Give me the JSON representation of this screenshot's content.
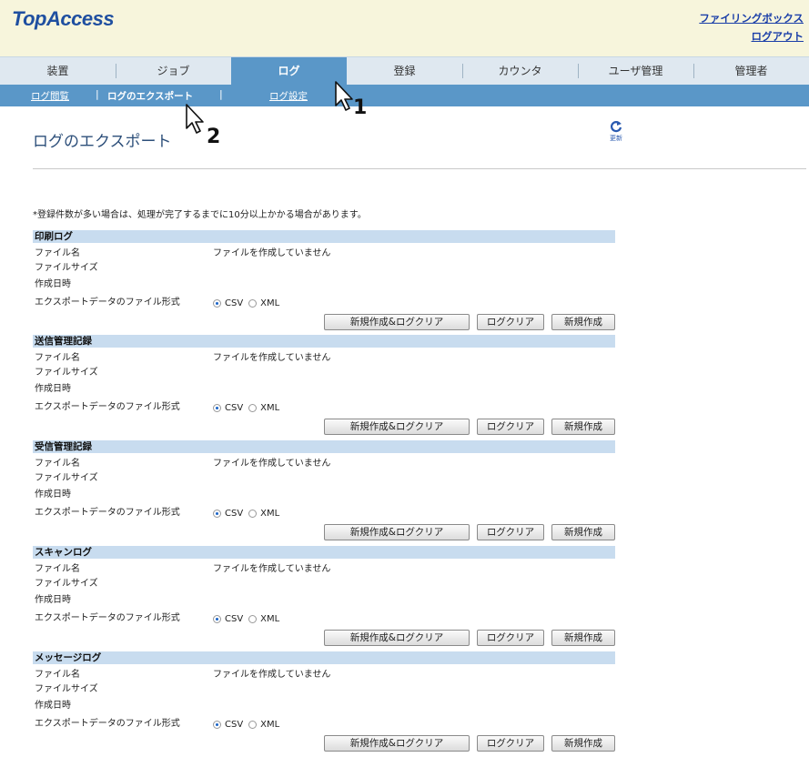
{
  "app": {
    "logo": "TopAccess"
  },
  "header_links": {
    "filing_box": "ファイリングボックス",
    "logout": "ログアウト"
  },
  "tabs": [
    {
      "label": "装置"
    },
    {
      "label": "ジョブ"
    },
    {
      "label": "ログ"
    },
    {
      "label": "登録"
    },
    {
      "label": "カウンタ"
    },
    {
      "label": "ユーザ管理"
    },
    {
      "label": "管理者"
    }
  ],
  "active_tab": "ログ",
  "subnav": {
    "view": "ログ閲覧",
    "sep": "|",
    "export": "ログのエクスポート",
    "settings": "ログ設定"
  },
  "page": {
    "title": "ログのエクスポート",
    "refresh_label": "更新",
    "note": "*登録件数が多い場合は、処理が完了するまでに10分以上かかる場合があります。"
  },
  "field_labels": {
    "file_name": "ファイル名",
    "file_size": "ファイルサイズ",
    "created": "作成日時",
    "format": "エクスポートデータのファイル形式"
  },
  "status_text": "ファイルを作成していません",
  "format_options": {
    "csv": "CSV",
    "xml": "XML",
    "selected": "CSV"
  },
  "buttons": {
    "create_clear": "新規作成&ログクリア",
    "clear": "ログクリア",
    "create": "新規作成"
  },
  "sections": [
    {
      "title": "印刷ログ"
    },
    {
      "title": "送信管理記録"
    },
    {
      "title": "受信管理記録"
    },
    {
      "title": "スキャンログ"
    },
    {
      "title": "メッセージログ"
    }
  ],
  "callouts": {
    "c1": "1",
    "c2": "2"
  }
}
